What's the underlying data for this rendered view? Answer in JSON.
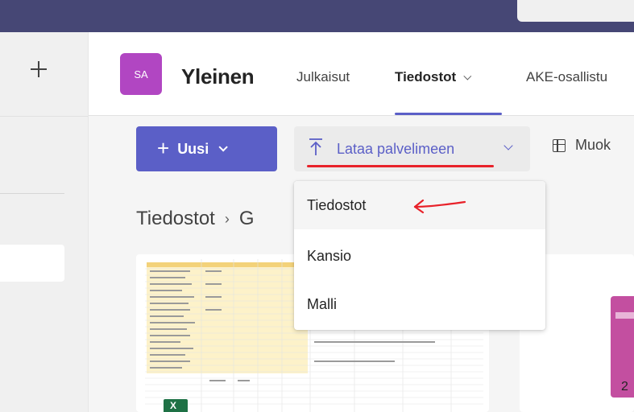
{
  "header": {
    "avatar_initials": "SA",
    "channel_name": "Yleinen",
    "tabs": [
      {
        "label": "Julkaisut"
      },
      {
        "label": "Tiedostot"
      },
      {
        "label": "AKE-osallistu"
      }
    ]
  },
  "toolbar": {
    "new_label": "Uusi",
    "upload_label": "Lataa palvelimeen",
    "edit_label": "Muok"
  },
  "breadcrumb": {
    "root": "Tiedostot",
    "current": "G"
  },
  "upload_menu": {
    "items": [
      {
        "label": "Tiedostot"
      },
      {
        "label": "Kansio"
      },
      {
        "label": "Malli"
      }
    ]
  },
  "files": {
    "second_card_text": "2"
  },
  "colors": {
    "title_bar": "#464775",
    "brand": "#5b5fc7",
    "annotation_red": "#e8222a",
    "avatar": "#b146c2",
    "excel": "#1e7145"
  },
  "icons": {
    "add": "plus-icon",
    "upload": "upload-icon",
    "edit_grid": "table-icon",
    "annotation": "red-arrow-icon"
  }
}
